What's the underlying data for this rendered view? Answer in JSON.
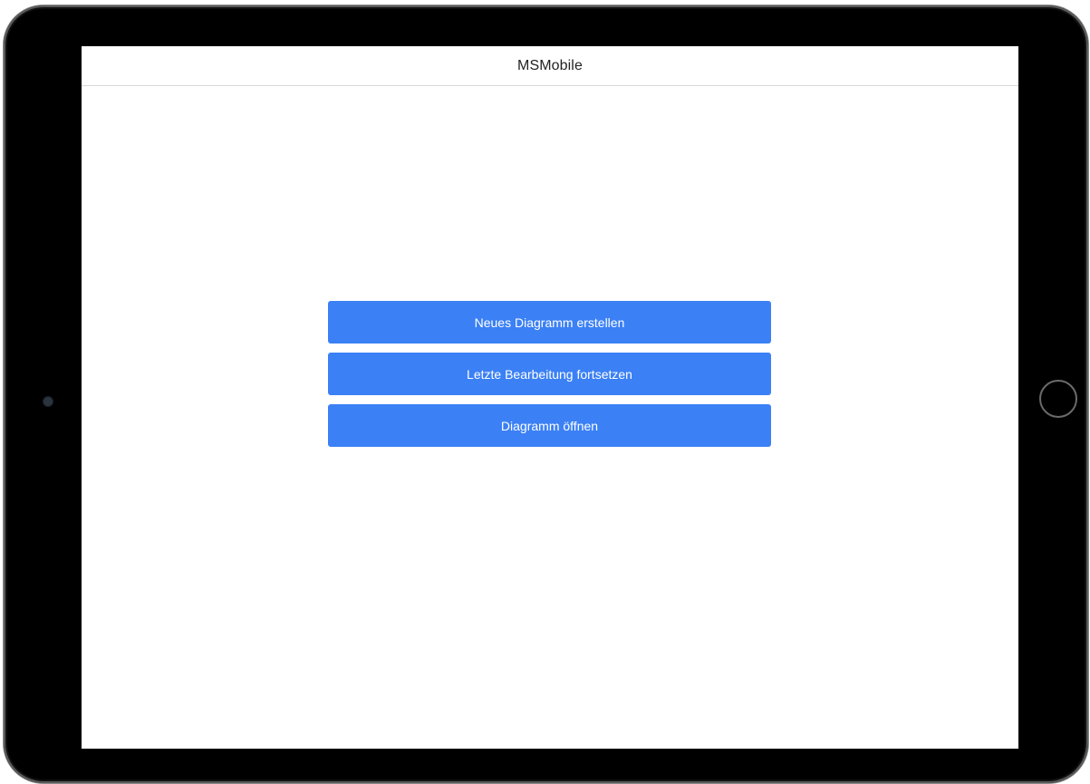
{
  "app": {
    "title": "MSMobile"
  },
  "menu": {
    "new_diagram_label": "Neues Diagramm erstellen",
    "continue_editing_label": "Letzte Bearbeitung fortsetzen",
    "open_diagram_label": "Diagramm öffnen"
  },
  "colors": {
    "button_background": "#3b80f5",
    "button_text": "#ffffff",
    "header_text": "#222222",
    "device_frame": "#000000"
  }
}
